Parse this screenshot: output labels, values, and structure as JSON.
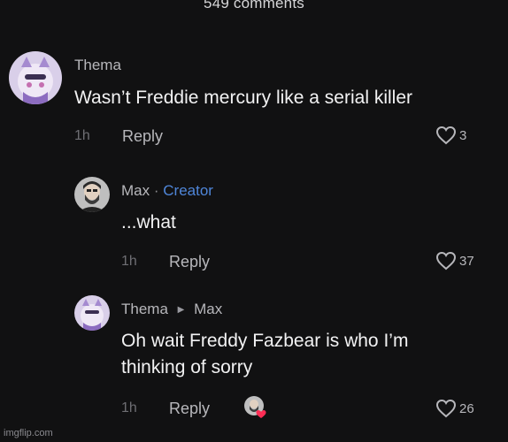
{
  "header": {
    "comment_count_label": "549 comments"
  },
  "comments": [
    {
      "author": "Thema",
      "text": "Wasn’t Freddie mercury like a serial killer",
      "time": "1h",
      "reply_label": "Reply",
      "likes": "3",
      "avatar_icon": "anime-avatar-icon"
    },
    {
      "author": "Max",
      "separator": "·",
      "badge": "Creator",
      "text": "...what",
      "time": "1h",
      "reply_label": "Reply",
      "likes": "37",
      "avatar_icon": "bearded-man-avatar-icon"
    },
    {
      "author": "Thema",
      "reply_to": "Max",
      "text_line1": "Oh wait Freddy Fazbear is who I’m",
      "text_line2": "thinking of sorry",
      "time": "1h",
      "reply_label": "Reply",
      "likes": "26",
      "avatar_icon": "anime-avatar-icon"
    }
  ],
  "watermark": "imgflip.com",
  "colors": {
    "background": "#111112",
    "creator_badge": "#4f86d9",
    "creator_heart": "#ff2d55"
  }
}
